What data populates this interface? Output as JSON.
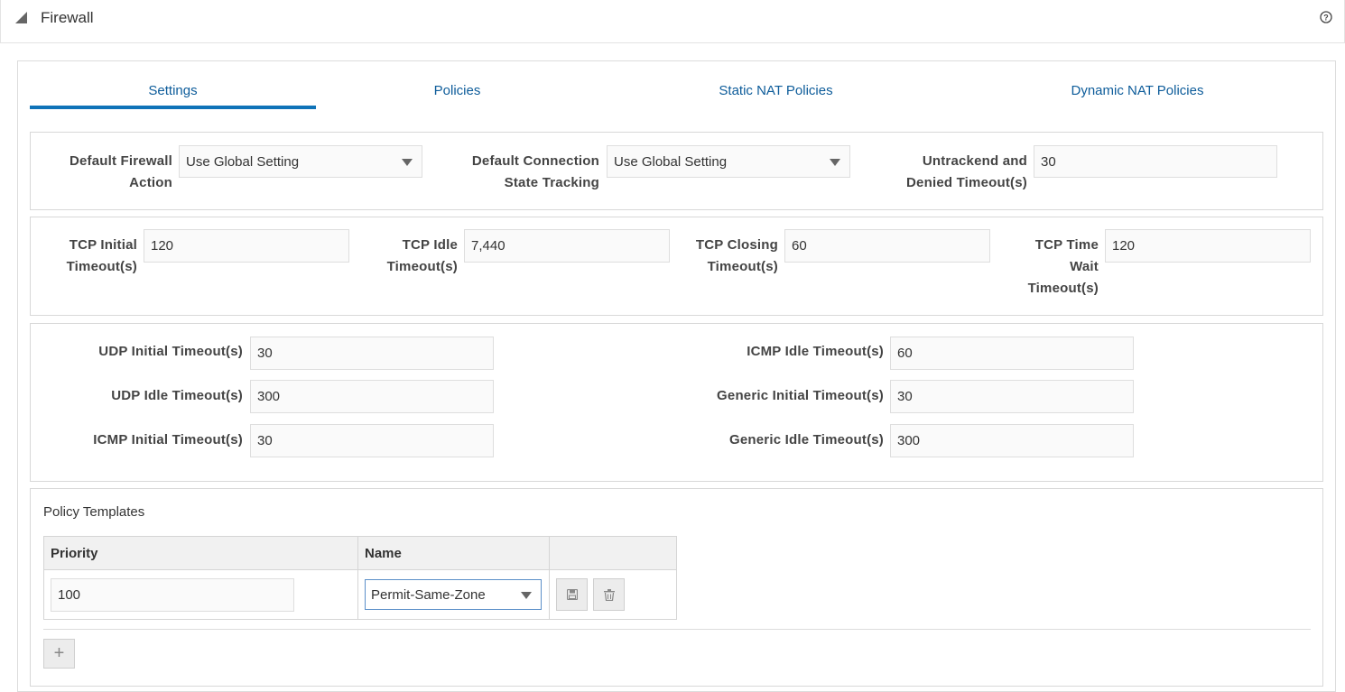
{
  "header": {
    "title": "Firewall"
  },
  "tabs": [
    "Settings",
    "Policies",
    "Static NAT Policies",
    "Dynamic NAT Policies"
  ],
  "general": {
    "default_firewall_action": {
      "label_line1": "Default Firewall",
      "label_line2": "Action",
      "value": "Use Global Setting"
    },
    "default_connection_state": {
      "label_line1": "Default Connection",
      "label_line2": "State Tracking",
      "value": "Use Global Setting"
    },
    "untracked_denied_timeout": {
      "label_line1": "Untrackend and",
      "label_line2": "Denied Timeout(s)",
      "value": "30"
    }
  },
  "tcp": {
    "initial": {
      "label_line1": "TCP Initial",
      "label_line2": "Timeout(s)",
      "value": "120"
    },
    "idle": {
      "label_line1": "TCP Idle",
      "label_line2": "Timeout(s)",
      "value": "7,440"
    },
    "closing": {
      "label_line1": "TCP Closing",
      "label_line2": "Timeout(s)",
      "value": "60"
    },
    "time_wait": {
      "label_line1": "TCP Time",
      "label_line2": "Wait",
      "label_line3": "Timeout(s)",
      "value": "120"
    }
  },
  "other": {
    "udp_initial": {
      "label": "UDP Initial Timeout(s)",
      "value": "30"
    },
    "udp_idle": {
      "label": "UDP Idle Timeout(s)",
      "value": "300"
    },
    "icmp_initial": {
      "label": "ICMP Initial Timeout(s)",
      "value": "30"
    },
    "icmp_idle": {
      "label": "ICMP Idle Timeout(s)",
      "value": "60"
    },
    "generic_initial": {
      "label": "Generic Initial Timeout(s)",
      "value": "30"
    },
    "generic_idle": {
      "label": "Generic Idle Timeout(s)",
      "value": "300"
    }
  },
  "policy_templates": {
    "title": "Policy Templates",
    "columns": [
      "Priority",
      "Name",
      ""
    ],
    "rows": [
      {
        "priority": "100",
        "name": "Permit-Same-Zone"
      }
    ],
    "add_label": "+"
  },
  "icons": [
    "collapse-triangle-icon",
    "help-icon",
    "dropdown-caret-icon",
    "save-icon",
    "trash-icon",
    "plus-icon"
  ],
  "colors": {
    "accent": "#0f73b8",
    "tab_text": "#0d5c9a"
  }
}
